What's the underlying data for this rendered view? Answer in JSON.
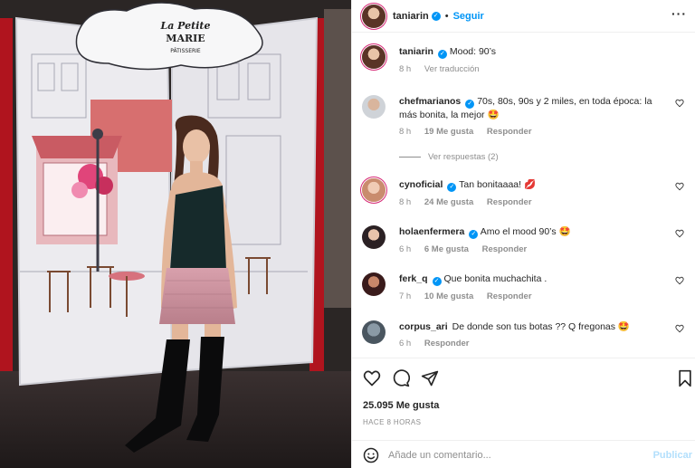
{
  "photo": {
    "sign_top": "La Petite",
    "sign_mid": "MARIE",
    "sign_sub": "PÂTISSERIE",
    "description_icon": "photo-post"
  },
  "header": {
    "username": "taniarin",
    "follow_label": "Seguir",
    "more_icon": "more-horizontal-icon"
  },
  "caption": {
    "username": "taniarin",
    "text": "Mood: 90’s",
    "time": "8 h",
    "translate_label": "Ver traducción"
  },
  "comments": [
    {
      "username": "chefmarianos",
      "verified": true,
      "text": "70s, 80s, 90s y 2 miles, en toda época: la más bonita, la mejor 🤩",
      "time": "8 h",
      "likes": "19 Me gusta",
      "reply": "Responder"
    },
    {
      "username": "cynoficial",
      "verified": true,
      "text": "Tan bonitaaaa! 💋",
      "time": "8 h",
      "likes": "24 Me gusta",
      "reply": "Responder"
    },
    {
      "username": "holaenfermera",
      "verified": true,
      "text": "Amo el mood 90’s 🤩",
      "time": "6 h",
      "likes": "6 Me gusta",
      "reply": "Responder"
    },
    {
      "username": "ferk_q",
      "verified": true,
      "text": "Que bonita muchachita .",
      "time": "7 h",
      "likes": "10 Me gusta",
      "reply": "Responder"
    },
    {
      "username": "corpus_ari",
      "verified": false,
      "text": "De donde son tus botas ?? Q fregonas 🤩",
      "time": "6 h",
      "likes": "",
      "reply": "Responder"
    }
  ],
  "view_replies_label": "Ver respuestas (2)",
  "actions": {
    "likes_count": "25.095 Me gusta",
    "time_ago": "HACE 8 HORAS",
    "comment_placeholder": "Añade un comentario...",
    "publish_label": "Publicar"
  },
  "colors": {
    "accent_blue": "#0095f6",
    "publish_disabled": "#b2dffc",
    "muted_text": "#8e8e8e",
    "border": "#efefef"
  }
}
